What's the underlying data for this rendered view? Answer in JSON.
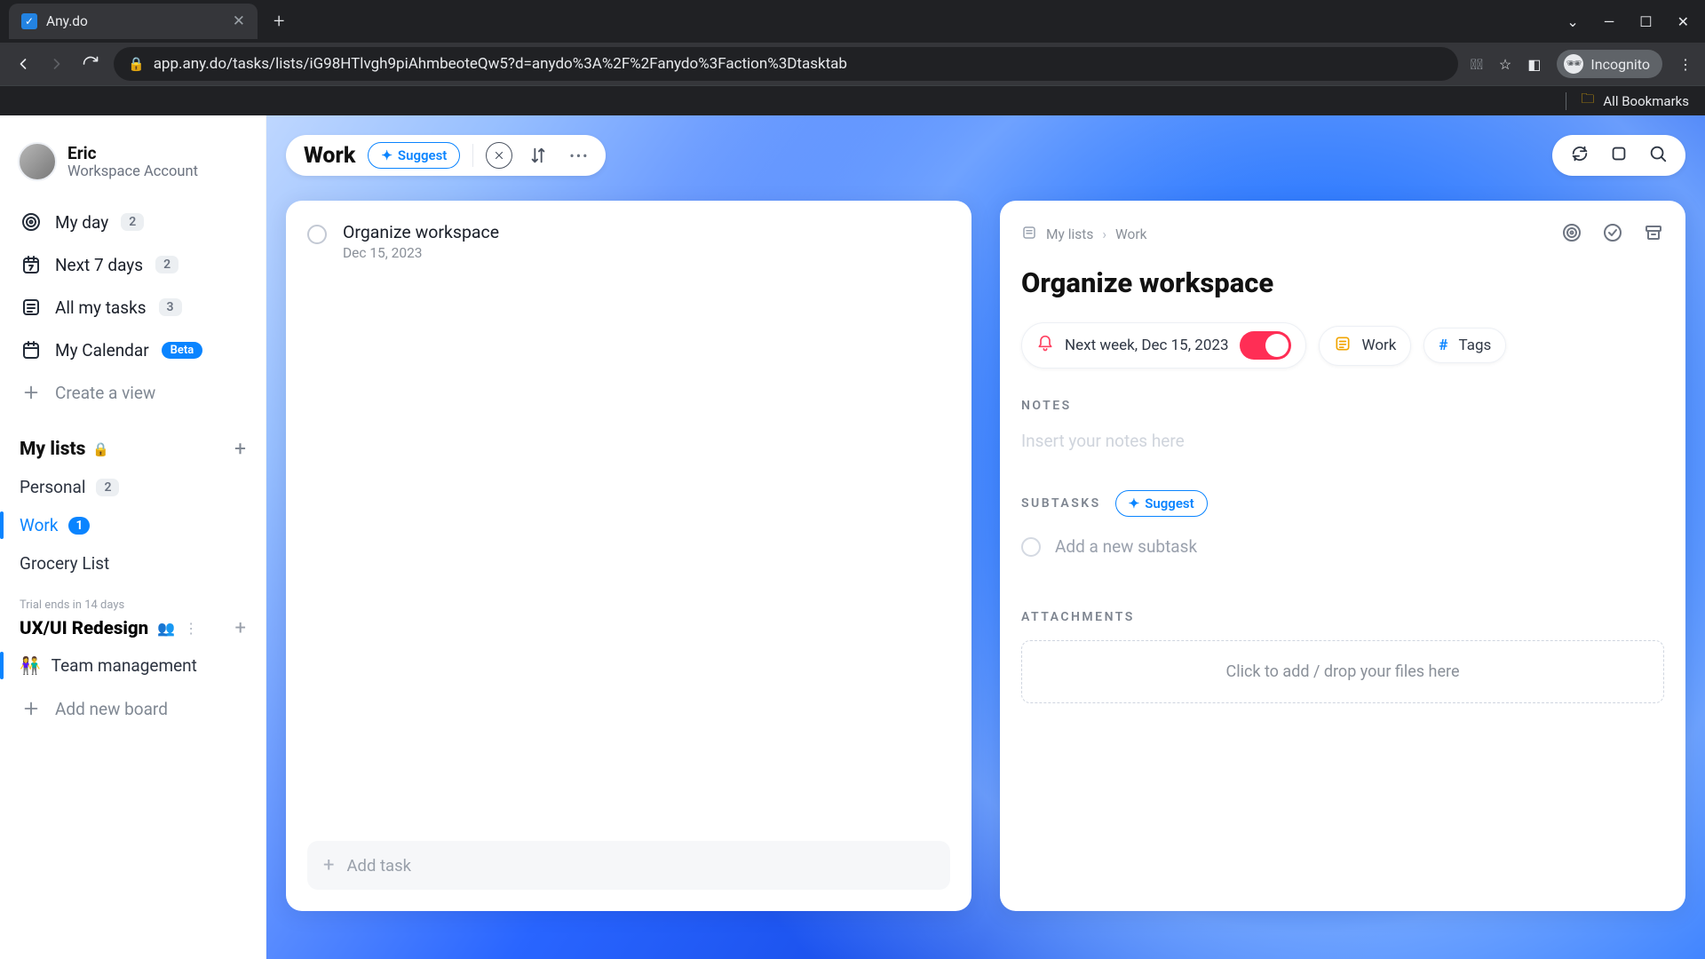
{
  "browser": {
    "tab_title": "Any.do",
    "url": "app.any.do/tasks/lists/iG98HTlvgh9piAhmbeoteQw5?d=anydo%3A%2F%2Fanydo%3Faction%3Dtasktab",
    "incognito_label": "Incognito",
    "all_bookmarks": "All Bookmarks"
  },
  "user": {
    "name": "Eric",
    "account": "Workspace Account"
  },
  "nav": {
    "my_day": "My day",
    "my_day_badge": "2",
    "next7": "Next 7 days",
    "next7_badge": "2",
    "all_tasks": "All my tasks",
    "all_tasks_badge": "3",
    "calendar": "My Calendar",
    "calendar_badge": "Beta",
    "create_view": "Create a view"
  },
  "lists": {
    "heading": "My lists",
    "personal": "Personal",
    "personal_badge": "2",
    "work": "Work",
    "work_badge": "1",
    "grocery": "Grocery List"
  },
  "project": {
    "trial": "Trial ends in 14 days",
    "name": "UX/UI Redesign",
    "board_emoji": "👫",
    "board": "Team management",
    "add_board": "Add new board"
  },
  "header": {
    "list_name": "Work",
    "suggest": "Suggest"
  },
  "task_list": {
    "item_title": "Organize workspace",
    "item_date": "Dec 15, 2023",
    "add_task": "Add task"
  },
  "detail": {
    "bc_root": "My lists",
    "bc_list": "Work",
    "title": "Organize workspace",
    "reminder": "Next week, Dec 15, 2023",
    "list_chip": "Work",
    "tags_chip": "Tags",
    "notes_label": "NOTES",
    "notes_ph": "Insert your notes here",
    "subtasks_label": "SUBTASKS",
    "subtasks_suggest": "Suggest",
    "subtask_ph": "Add a new subtask",
    "att_label": "ATTACHMENTS",
    "dropzone": "Click to add / drop your files here"
  }
}
